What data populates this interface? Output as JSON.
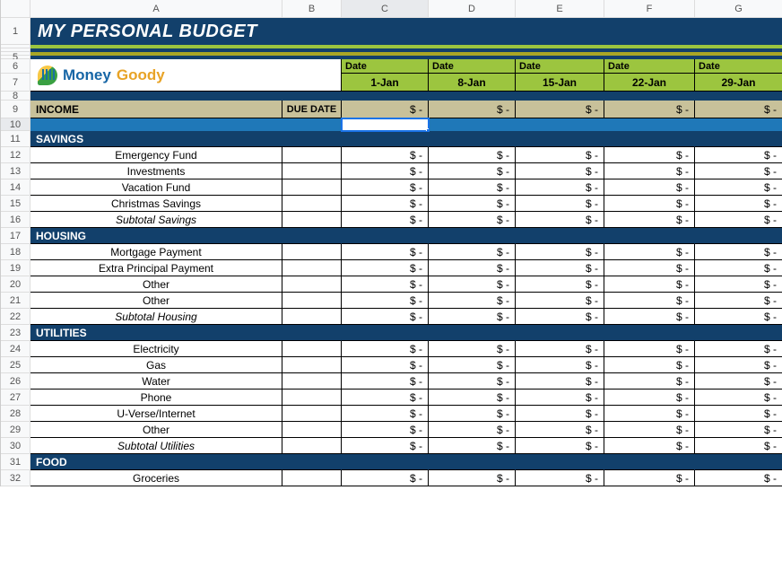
{
  "columns": [
    "A",
    "B",
    "C",
    "D",
    "E",
    "F",
    "G"
  ],
  "title": "MY PERSONAL BUDGET",
  "logo": {
    "word1": "Money",
    "word2": "Goody"
  },
  "date_label": "Date",
  "dates": [
    "1-Jan",
    "8-Jan",
    "15-Jan",
    "22-Jan",
    "29-Jan"
  ],
  "income_label": "INCOME",
  "due_label": "DUE DATE",
  "dollar_placeholder": "$ -",
  "row_labels": {
    "r1": "1",
    "r5": "5",
    "r6": "6",
    "r7": "7",
    "r8": "8",
    "r9": "9",
    "r10": "10",
    "r11": "11",
    "r12": "12",
    "r13": "13",
    "r14": "14",
    "r15": "15",
    "r16": "16",
    "r17": "17",
    "r18": "18",
    "r19": "19",
    "r20": "20",
    "r21": "21",
    "r22": "22",
    "r23": "23",
    "r24": "24",
    "r25": "25",
    "r26": "26",
    "r27": "27",
    "r28": "28",
    "r29": "29",
    "r30": "30",
    "r31": "31",
    "r32": "32"
  },
  "sections": [
    {
      "head": "SAVINGS",
      "items": [
        "Emergency Fund",
        "Investments",
        "Vacation Fund",
        "Christmas Savings"
      ],
      "subtotal": "Subtotal Savings"
    },
    {
      "head": "HOUSING",
      "items": [
        "Mortgage Payment",
        "Extra Principal Payment",
        "Other",
        "Other"
      ],
      "subtotal": "Subtotal Housing"
    },
    {
      "head": "UTILITIES",
      "items": [
        "Electricity",
        "Gas",
        "Water",
        "Phone",
        "U-Verse/Internet",
        "Other"
      ],
      "subtotal": "Subtotal Utilities"
    },
    {
      "head": "FOOD",
      "items": [
        "Groceries"
      ],
      "subtotal": ""
    }
  ],
  "selected_cell": "C10"
}
